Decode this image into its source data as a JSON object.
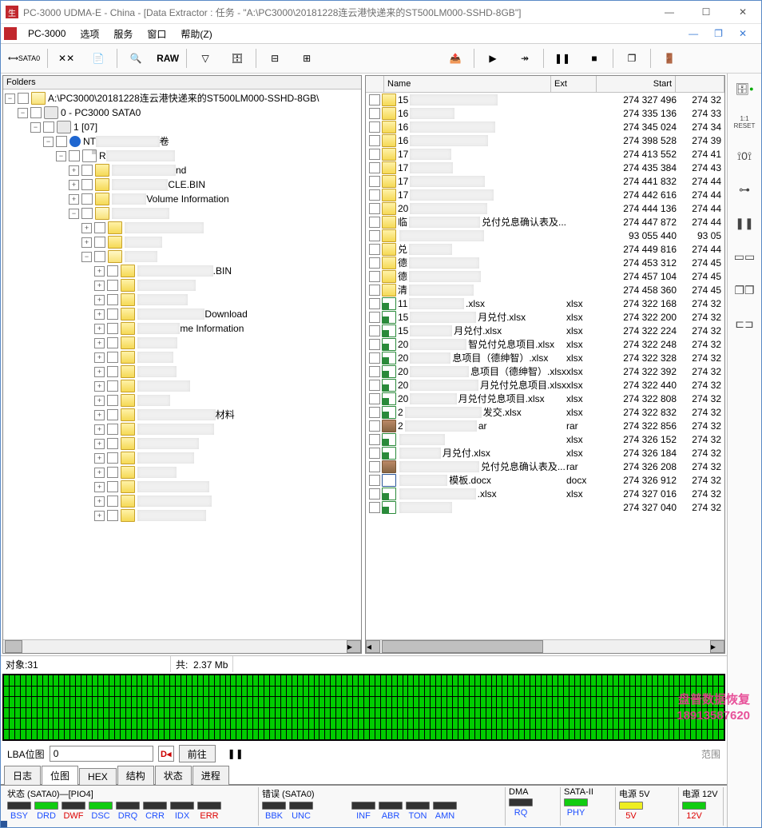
{
  "title": "PC-3000 UDMA-E - China - [Data Extractor : 任务 - \"A:\\PC3000\\20181228连云港快递来的ST500LM000-SSHD-8GB\"]",
  "menu": {
    "app": "PC-3000",
    "opt": "选项",
    "svc": "服务",
    "win": "窗口",
    "help": "帮助(Z)"
  },
  "toolbar": {
    "sata": "SATA0",
    "raw": "RAW"
  },
  "folders_label": "Folders",
  "tree": {
    "root": "A:\\PC3000\\20181228连云港快递来的ST500LM000-SSHD-8GB\\",
    "drive": "0 - PC3000 SATA0",
    "part": "1 [07]",
    "vol": "NT",
    "volTail": "卷",
    "r": "R",
    "nd": "nd",
    "recycle": "CLE.BIN",
    "svi": "Volume Information",
    "bin": ".BIN",
    "download": "Download",
    "me_info": "me Information",
    "cailiao": "材料"
  },
  "list": {
    "headers": {
      "name": "Name",
      "ext": "Ext",
      "start": "Start"
    },
    "rows": [
      {
        "t": "folder",
        "n": "15",
        "e": "",
        "s": "274 327 496",
        "s2": "274 32"
      },
      {
        "t": "folder",
        "n": "16",
        "e": "",
        "s": "274 335 136",
        "s2": "274 33"
      },
      {
        "t": "folder",
        "n": "16",
        "e": "",
        "s": "274 345 024",
        "s2": "274 34"
      },
      {
        "t": "folder",
        "n": "16",
        "e": "",
        "s": "274 398 528",
        "s2": "274 39"
      },
      {
        "t": "folder",
        "n": "17",
        "e": "",
        "s": "274 413 552",
        "s2": "274 41"
      },
      {
        "t": "folder",
        "n": "17",
        "e": "",
        "s": "274 435 384",
        "s2": "274 43"
      },
      {
        "t": "folder",
        "n": "17",
        "e": "",
        "s": "274 441 832",
        "s2": "274 44"
      },
      {
        "t": "folder",
        "n": "17",
        "e": "",
        "s": "274 442 616",
        "s2": "274 44"
      },
      {
        "t": "folder",
        "n": "20",
        "e": "",
        "s": "274 444 136",
        "s2": "274 44"
      },
      {
        "t": "folder",
        "n": "临",
        "tail": "兑付兑息确认表及...",
        "e": "",
        "s": "274 447 872",
        "s2": "274 44"
      },
      {
        "t": "folder",
        "n": "",
        "tail": "",
        "e": "",
        "s": "93 055 440",
        "s2": "93 05"
      },
      {
        "t": "folder",
        "n": "兑",
        "e": "",
        "s": "274 449 816",
        "s2": "274 44"
      },
      {
        "t": "folder",
        "n": "德",
        "e": "",
        "s": "274 453 312",
        "s2": "274 45"
      },
      {
        "t": "folder",
        "n": "德",
        "e": "",
        "s": "274 457 104",
        "s2": "274 45"
      },
      {
        "t": "folder",
        "n": "清",
        "e": "",
        "s": "274 458 360",
        "s2": "274 45"
      },
      {
        "t": "xls",
        "n": "11",
        "tail": ".xlsx",
        "e": "xlsx",
        "s": "274 322 168",
        "s2": "274 32"
      },
      {
        "t": "xls",
        "n": "15",
        "tail": "月兑付.xlsx",
        "e": "xlsx",
        "s": "274 322 200",
        "s2": "274 32"
      },
      {
        "t": "xls",
        "n": "15",
        "tail": "月兑付.xlsx",
        "e": "xlsx",
        "s": "274 322 224",
        "s2": "274 32"
      },
      {
        "t": "xls",
        "n": "20",
        "tail": "智兑付兑息项目.xlsx",
        "e": "xlsx",
        "s": "274 322 248",
        "s2": "274 32"
      },
      {
        "t": "xls",
        "n": "20",
        "tail": "息项目（德绅智）.xlsx",
        "e": "xlsx",
        "s": "274 322 328",
        "s2": "274 32"
      },
      {
        "t": "xls",
        "n": "20",
        "tail": "息项目（德绅智）.xlsx",
        "e": "xlsx",
        "s": "274 322 392",
        "s2": "274 32"
      },
      {
        "t": "xls",
        "n": "20",
        "tail": "月兑付兑息项目.xlsx",
        "e": "xlsx",
        "s": "274 322 440",
        "s2": "274 32"
      },
      {
        "t": "xls",
        "n": "20",
        "tail": "月兑付兑息项目.xlsx",
        "e": "xlsx",
        "s": "274 322 808",
        "s2": "274 32"
      },
      {
        "t": "xls",
        "n": "2",
        "tail": "发交.xlsx",
        "e": "xlsx",
        "s": "274 322 832",
        "s2": "274 32"
      },
      {
        "t": "rar",
        "n": "2",
        "tail": "ar",
        "e": "rar",
        "s": "274 322 856",
        "s2": "274 32"
      },
      {
        "t": "xls",
        "n": "",
        "tail": "",
        "e": "xlsx",
        "s": "274 326 152",
        "s2": "274 32"
      },
      {
        "t": "xls",
        "n": "",
        "tail": "月兑付.xlsx",
        "e": "xlsx",
        "s": "274 326 184",
        "s2": "274 32"
      },
      {
        "t": "rar",
        "n": "",
        "tail": "兑付兑息确认表及...",
        "e": "rar",
        "s": "274 326 208",
        "s2": "274 32"
      },
      {
        "t": "doc",
        "n": "",
        "tail": "模板.docx",
        "e": "docx",
        "s": "274 326 912",
        "s2": "274 32"
      },
      {
        "t": "xls",
        "n": "",
        "tail": ".xlsx",
        "e": "xlsx",
        "s": "274 327 016",
        "s2": "274 32"
      },
      {
        "t": "xls",
        "n": "",
        "tail": "",
        "e": "",
        "s": "274 327 040",
        "s2": "274 32"
      }
    ]
  },
  "status": {
    "objects": "对象:31",
    "total_label": "共:",
    "total": "2.37 Mb"
  },
  "lba": {
    "label": "LBA位图",
    "value": "0",
    "go": "前往"
  },
  "tabs": {
    "log": "日志",
    "bitmap": "位图",
    "hex": "HEX",
    "struct": "结构",
    "state": "状态",
    "proc": "进程"
  },
  "sb": {
    "state": "状态 (SATA0)—[PIO4]",
    "err": "错误 (SATA0)",
    "dma": "DMA",
    "sata2": "SATA-II",
    "p5": "电源 5V",
    "p12": "电源 12V",
    "cells": {
      "bsy": "BSY",
      "drd": "DRD",
      "dwf": "DWF",
      "dsc": "DSC",
      "drq": "DRQ",
      "crr": "CRR",
      "idx": "IDX",
      "errc": "ERR",
      "bbk": "BBK",
      "unc": "UNC",
      "inf": "INF",
      "abr": "ABR",
      "ton": "TON",
      "amn": "AMN",
      "rq": "RQ",
      "phy": "PHY",
      "v5": "5V",
      "v12": "12V"
    }
  },
  "watermark": {
    "l1": "盘普数据恢复",
    "l2": "18913587620"
  },
  "sidebar": {
    "reset_top": "1:1",
    "reset": "RESET"
  }
}
